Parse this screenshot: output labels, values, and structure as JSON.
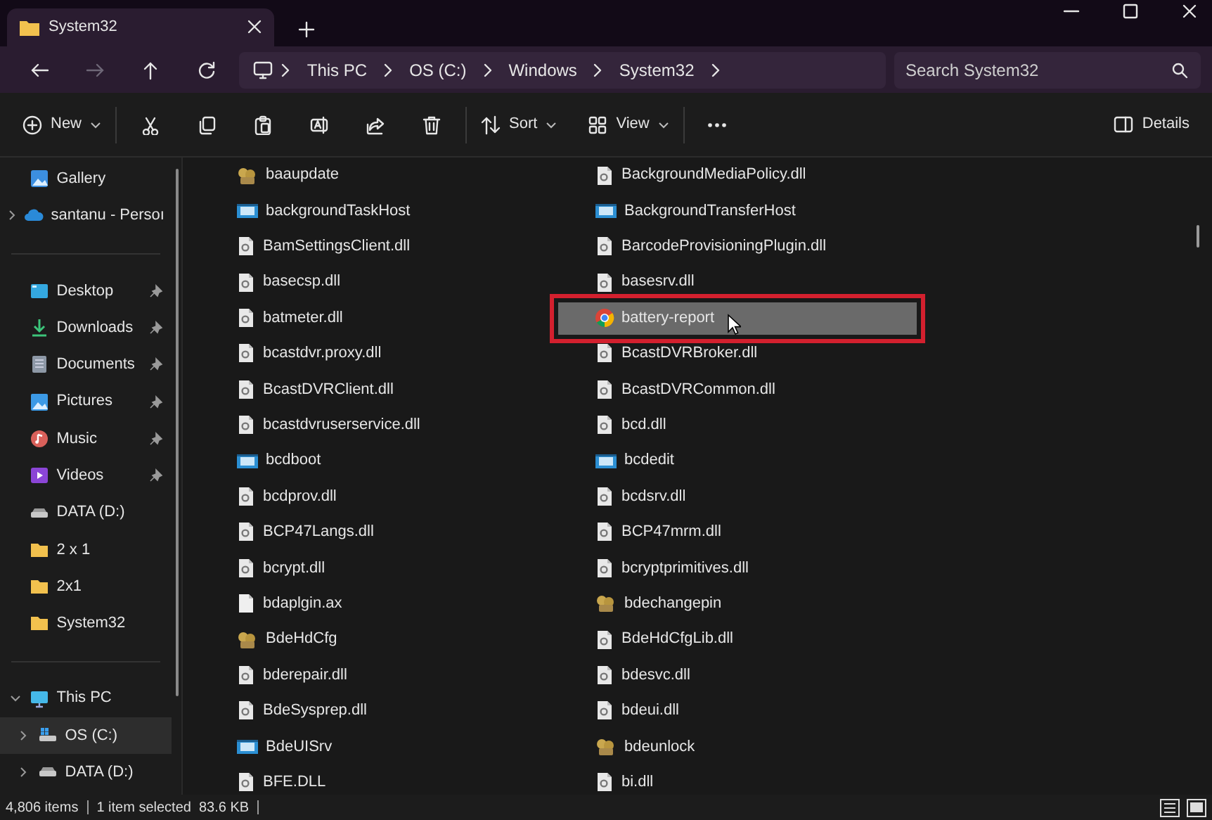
{
  "window": {
    "tab_title": "System32"
  },
  "address": {
    "crumbs": [
      "This PC",
      "OS (C:)",
      "Windows",
      "System32"
    ],
    "search_placeholder": "Search System32"
  },
  "toolbar": {
    "new": "New",
    "sort": "Sort",
    "view": "View",
    "details": "Details"
  },
  "sidebar": [
    {
      "items": [
        {
          "label": "Gallery",
          "kind": "gallery",
          "selected": false
        },
        {
          "label": "santanu - Persoı",
          "kind": "cloud",
          "expanded": false,
          "selected": false
        }
      ]
    },
    {
      "items": [
        {
          "label": "Desktop",
          "kind": "desktop",
          "pinned": true,
          "selected": false
        },
        {
          "label": "Downloads",
          "kind": "download",
          "pinned": true,
          "selected": false
        },
        {
          "label": "Documents",
          "kind": "documents",
          "pinned": true,
          "selected": false
        },
        {
          "label": "Pictures",
          "kind": "pictures",
          "pinned": true,
          "selected": false
        },
        {
          "label": "Music",
          "kind": "music",
          "pinned": true,
          "selected": false
        },
        {
          "label": "Videos",
          "kind": "videos",
          "pinned": true,
          "selected": false
        },
        {
          "label": "DATA (D:)",
          "kind": "drive",
          "pinned": false,
          "selected": false
        },
        {
          "label": "2 x 1",
          "kind": "folder",
          "pinned": false,
          "selected": false
        },
        {
          "label": "2x1",
          "kind": "folder",
          "pinned": false,
          "selected": false
        },
        {
          "label": "System32",
          "kind": "folder",
          "pinned": false,
          "selected": false
        }
      ]
    },
    {
      "items": [
        {
          "label": "This PC",
          "kind": "pc",
          "expanded": true,
          "selected": false,
          "children": [
            {
              "label": "OS (C:)",
              "kind": "windrive",
              "expanded": false,
              "selected": true
            },
            {
              "label": "DATA (D:)",
              "kind": "drive",
              "expanded": false,
              "selected": false
            }
          ]
        }
      ]
    }
  ],
  "files": [
    {
      "name": "baaupdate",
      "kind": "emblem",
      "selected": false,
      "outlined": false
    },
    {
      "name": "backgroundTaskHost",
      "kind": "app",
      "selected": false,
      "outlined": false
    },
    {
      "name": "BamSettingsClient.dll",
      "kind": "dll",
      "selected": false,
      "outlined": false
    },
    {
      "name": "basecsp.dll",
      "kind": "dll",
      "selected": false,
      "outlined": false
    },
    {
      "name": "batmeter.dll",
      "kind": "dll",
      "selected": false,
      "outlined": false
    },
    {
      "name": "bcastdvr.proxy.dll",
      "kind": "dll",
      "selected": false,
      "outlined": false
    },
    {
      "name": "BcastDVRClient.dll",
      "kind": "dll",
      "selected": false,
      "outlined": false
    },
    {
      "name": "bcastdvruserservice.dll",
      "kind": "dll",
      "selected": false,
      "outlined": false
    },
    {
      "name": "bcdboot",
      "kind": "app",
      "selected": false,
      "outlined": false
    },
    {
      "name": "bcdprov.dll",
      "kind": "dll",
      "selected": false,
      "outlined": false
    },
    {
      "name": "BCP47Langs.dll",
      "kind": "dll",
      "selected": false,
      "outlined": false
    },
    {
      "name": "bcrypt.dll",
      "kind": "dll",
      "selected": false,
      "outlined": false
    },
    {
      "name": "bdaplgin.ax",
      "kind": "plain",
      "selected": false,
      "outlined": false
    },
    {
      "name": "BdeHdCfg",
      "kind": "emblem",
      "selected": false,
      "outlined": false
    },
    {
      "name": "bderepair.dll",
      "kind": "dll",
      "selected": false,
      "outlined": false
    },
    {
      "name": "BdeSysprep.dll",
      "kind": "dll",
      "selected": false,
      "outlined": false
    },
    {
      "name": "BdeUISrv",
      "kind": "app",
      "selected": false,
      "outlined": false
    },
    {
      "name": "BFE.DLL",
      "kind": "dll",
      "selected": false,
      "outlined": false
    },
    {
      "name": "BackgroundMediaPolicy.dll",
      "kind": "dll",
      "selected": false,
      "outlined": false
    },
    {
      "name": "BackgroundTransferHost",
      "kind": "app",
      "selected": false,
      "outlined": false
    },
    {
      "name": "BarcodeProvisioningPlugin.dll",
      "kind": "dll",
      "selected": false,
      "outlined": false
    },
    {
      "name": "basesrv.dll",
      "kind": "dll",
      "selected": false,
      "outlined": false
    },
    {
      "name": "battery-report",
      "kind": "browser",
      "selected": true,
      "outlined": true
    },
    {
      "name": "BcastDVRBroker.dll",
      "kind": "dll",
      "selected": false,
      "outlined": false
    },
    {
      "name": "BcastDVRCommon.dll",
      "kind": "dll",
      "selected": false,
      "outlined": false
    },
    {
      "name": "bcd.dll",
      "kind": "dll",
      "selected": false,
      "outlined": false
    },
    {
      "name": "bcdedit",
      "kind": "app",
      "selected": false,
      "outlined": false
    },
    {
      "name": "bcdsrv.dll",
      "kind": "dll",
      "selected": false,
      "outlined": false
    },
    {
      "name": "BCP47mrm.dll",
      "kind": "dll",
      "selected": false,
      "outlined": false
    },
    {
      "name": "bcryptprimitives.dll",
      "kind": "dll",
      "selected": false,
      "outlined": false
    },
    {
      "name": "bdechangepin",
      "kind": "emblem",
      "selected": false,
      "outlined": false
    },
    {
      "name": "BdeHdCfgLib.dll",
      "kind": "dll",
      "selected": false,
      "outlined": false
    },
    {
      "name": "bdesvc.dll",
      "kind": "dll",
      "selected": false,
      "outlined": false
    },
    {
      "name": "bdeui.dll",
      "kind": "dll",
      "selected": false,
      "outlined": false
    },
    {
      "name": "bdeunlock",
      "kind": "emblem",
      "selected": false,
      "outlined": false
    },
    {
      "name": "bi.dll",
      "kind": "dll",
      "selected": false,
      "outlined": false
    }
  ],
  "status_bar": {
    "item_count": "4,806 items",
    "selection": "1 item selected",
    "size": "83.6 KB"
  }
}
